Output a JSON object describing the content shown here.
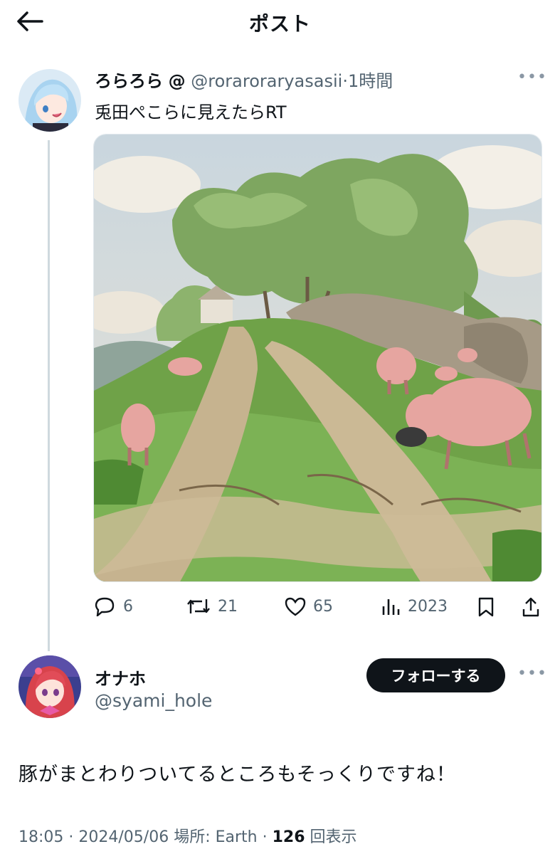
{
  "header": {
    "title": "ポスト",
    "back_icon": "arrow-left-icon"
  },
  "tweet": {
    "display_name": "ろらろら",
    "at_sign": "@",
    "handle": "@roraroraryasasii",
    "separator": "·",
    "time": "1時間",
    "text": "兎田ぺこらに見えたらRT",
    "stats": {
      "replies": "6",
      "retweets": "21",
      "likes": "65",
      "views": "2023"
    }
  },
  "reply": {
    "display_name": "オナホ",
    "handle": "@syami_hole",
    "follow_label": "フォローする",
    "text": "豚がまとわりついてるところもそっくりですね！",
    "footer": {
      "time": "18:05",
      "sep1": " · ",
      "date": "2024/05/06",
      "location": " 場所: Earth",
      "sep2": " · ",
      "views_count": "126",
      "views_label": " 回表示"
    }
  },
  "colors": {
    "text": "#0f1419",
    "secondary": "#536471",
    "button": "#0f1419",
    "thread_line": "#cfd9de"
  }
}
